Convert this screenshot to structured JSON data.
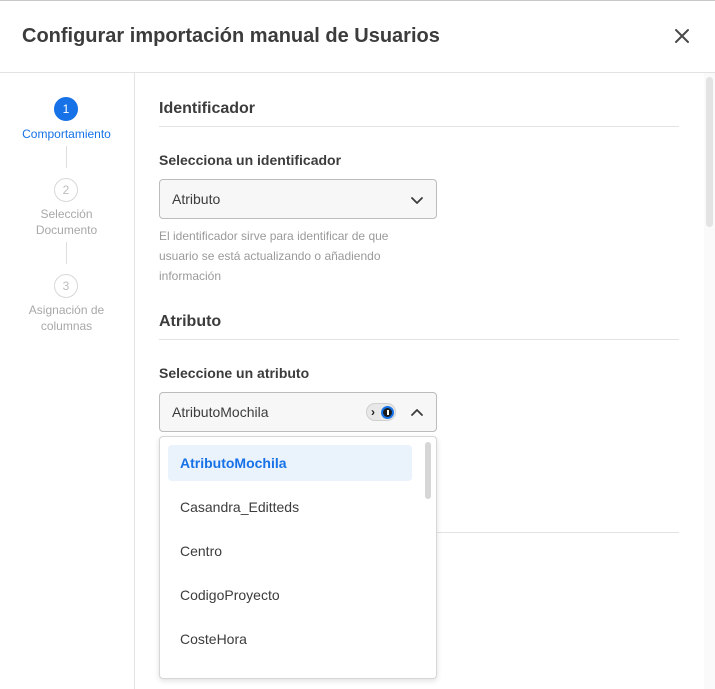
{
  "dialog": {
    "title": "Configurar importación manual de Usuarios"
  },
  "stepper": {
    "steps": [
      {
        "number": "1",
        "label": "Comportamiento",
        "state": "active"
      },
      {
        "number": "2",
        "label_line1": "Selección",
        "label_line2": "Documento",
        "state": "inactive"
      },
      {
        "number": "3",
        "label_line1": "Asignación de",
        "label_line2": "columnas",
        "state": "inactive"
      }
    ]
  },
  "identifier_section": {
    "title": "Identificador",
    "field_label": "Selecciona un identificador",
    "selected_value": "Atributo",
    "helper_lines": [
      "El identificador sirve para identificar de que",
      "usuario se está actualizando o añadiendo",
      "información"
    ]
  },
  "attribute_section": {
    "title": "Atributo",
    "field_label": "Seleccione un atributo",
    "selected_value": "AtributoMochila",
    "options": [
      "AtributoMochila",
      "Casandra_Editteds",
      "Centro",
      "CodigoProyecto",
      "CosteHora"
    ]
  },
  "colors": {
    "accent": "#1672e6",
    "selected_option_bg": "#eaf2fc"
  },
  "icons": {
    "close": "close-icon",
    "chevron_down": "chevron-down-icon",
    "chevron_up": "chevron-up-icon",
    "extension_badge": "extension-badge-icon"
  }
}
